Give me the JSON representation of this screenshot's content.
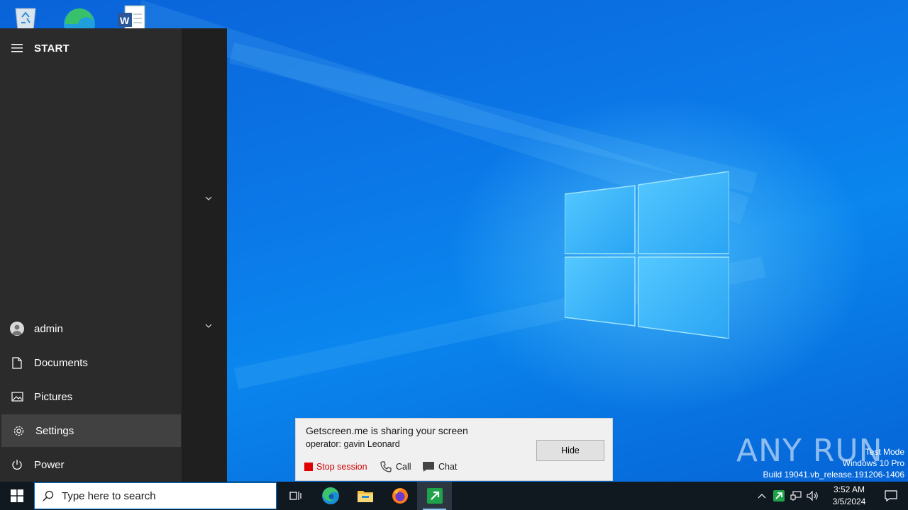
{
  "start_menu": {
    "title": "START",
    "items": [
      {
        "label": "admin",
        "icon": "user-avatar-icon"
      },
      {
        "label": "Documents",
        "icon": "document-icon"
      },
      {
        "label": "Pictures",
        "icon": "pictures-icon"
      },
      {
        "label": "Settings",
        "icon": "gear-icon"
      },
      {
        "label": "Power",
        "icon": "power-icon"
      }
    ]
  },
  "desktop_icons": [
    "recycle-bin-icon",
    "edge-icon",
    "word-icon"
  ],
  "getscreen_popup": {
    "title": "Getscreen.me is sharing your screen",
    "operator": "operator: gavin Leonard",
    "hide_label": "Hide",
    "stop_label": "Stop session",
    "call_label": "Call",
    "chat_label": "Chat",
    "stop_color": "#d00000"
  },
  "watermark": {
    "brand": "ANY RUN",
    "test_mode": "Test Mode",
    "os": "Windows 10 Pro",
    "build": "Build 19041.vb_release.191206-1406"
  },
  "taskbar": {
    "search_placeholder": "Type here to search",
    "apps": [
      "task-view-icon",
      "edge-icon",
      "file-explorer-icon",
      "firefox-icon",
      "getscreen-icon"
    ],
    "clock_time": "3:52 AM",
    "clock_date": "3/5/2024"
  },
  "colors": {
    "accent": "#0078d7",
    "taskbar": "#101820",
    "start_bg": "#2b2b2b"
  }
}
